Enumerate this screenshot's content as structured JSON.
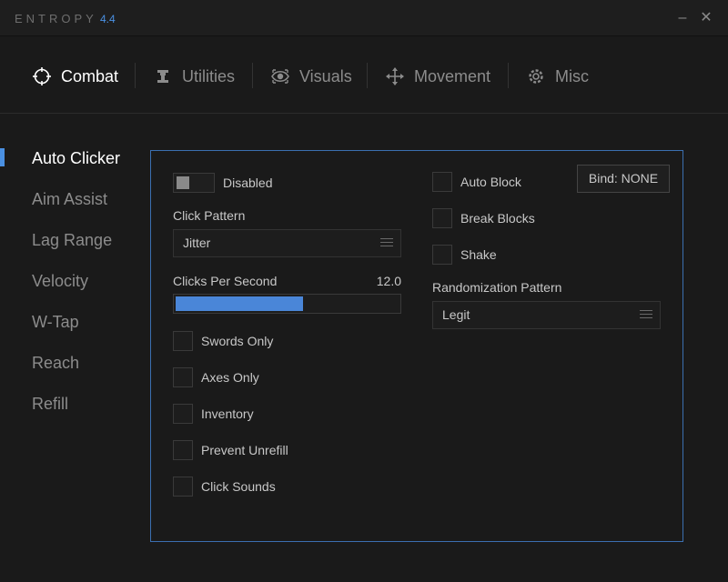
{
  "app": {
    "title": "ENTROPY",
    "version": "4.4"
  },
  "window": {
    "minimize_glyph": "–",
    "close_glyph": "✕"
  },
  "tabs": [
    {
      "label": "Combat",
      "icon": "crosshair-icon",
      "active": true
    },
    {
      "label": "Utilities",
      "icon": "anvil-icon",
      "active": false
    },
    {
      "label": "Visuals",
      "icon": "eye-icon",
      "active": false
    },
    {
      "label": "Movement",
      "icon": "move-arrows-icon",
      "active": false
    },
    {
      "label": "Misc",
      "icon": "cog-icon",
      "active": false
    }
  ],
  "sidebar": {
    "items": [
      {
        "label": "Auto Clicker",
        "active": true
      },
      {
        "label": "Aim Assist",
        "active": false
      },
      {
        "label": "Lag Range",
        "active": false
      },
      {
        "label": "Velocity",
        "active": false
      },
      {
        "label": "W-Tap",
        "active": false
      },
      {
        "label": "Reach",
        "active": false
      },
      {
        "label": "Refill",
        "active": false
      }
    ]
  },
  "module": {
    "enabled_toggle": {
      "label": "Disabled",
      "on": false
    },
    "click_pattern": {
      "label": "Click Pattern",
      "value": "Jitter"
    },
    "cps": {
      "label": "Clicks Per Second",
      "value": "12.0",
      "fill_fraction": 0.57
    },
    "left_checks": [
      {
        "label": "Swords Only",
        "checked": false
      },
      {
        "label": "Axes Only",
        "checked": false
      },
      {
        "label": "Inventory",
        "checked": false
      },
      {
        "label": "Prevent Unrefill",
        "checked": false
      },
      {
        "label": "Click Sounds",
        "checked": false
      }
    ],
    "right_checks": [
      {
        "label": "Auto Block",
        "checked": false
      },
      {
        "label": "Break Blocks",
        "checked": false
      },
      {
        "label": "Shake",
        "checked": false
      }
    ],
    "bind": {
      "label": "Bind: NONE"
    },
    "randomization": {
      "label": "Randomization Pattern",
      "value": "Legit"
    }
  },
  "colors": {
    "accent": "#4a90e2",
    "background": "#1a1a1a",
    "panel_border": "#3b6fb0"
  }
}
